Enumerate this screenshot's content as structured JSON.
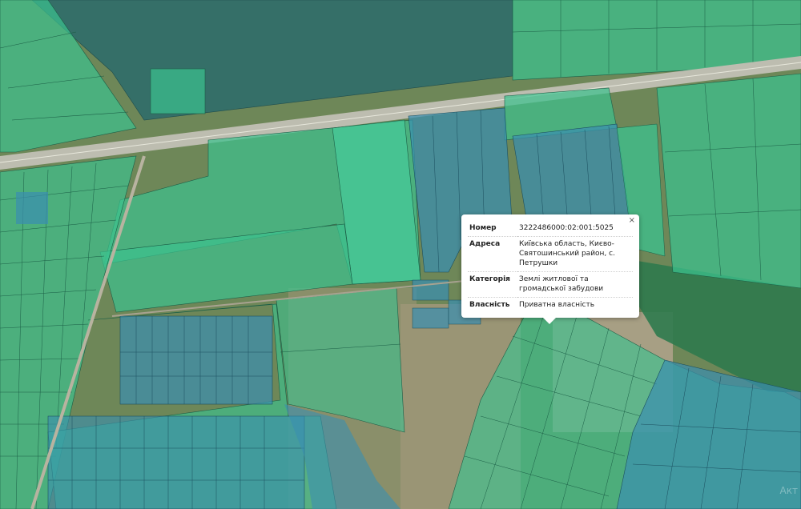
{
  "popup": {
    "close_label": "×",
    "rows": [
      {
        "label": "Номер",
        "value": "3222486000:02:001:5025"
      },
      {
        "label": "Адреса",
        "value": "Київська область, Києво-Святошинський район, с. Петрушки"
      },
      {
        "label": "Категорія",
        "value": "Землі житлової та громадської забудови"
      },
      {
        "label": "Власність",
        "value": "Приватна власність"
      }
    ]
  },
  "watermark": "Акт",
  "colors": {
    "parcel_green": "#2fb38a",
    "parcel_blue": "#3a8fb0",
    "road": "#bdbdb0",
    "forest": "#2c6b45"
  }
}
